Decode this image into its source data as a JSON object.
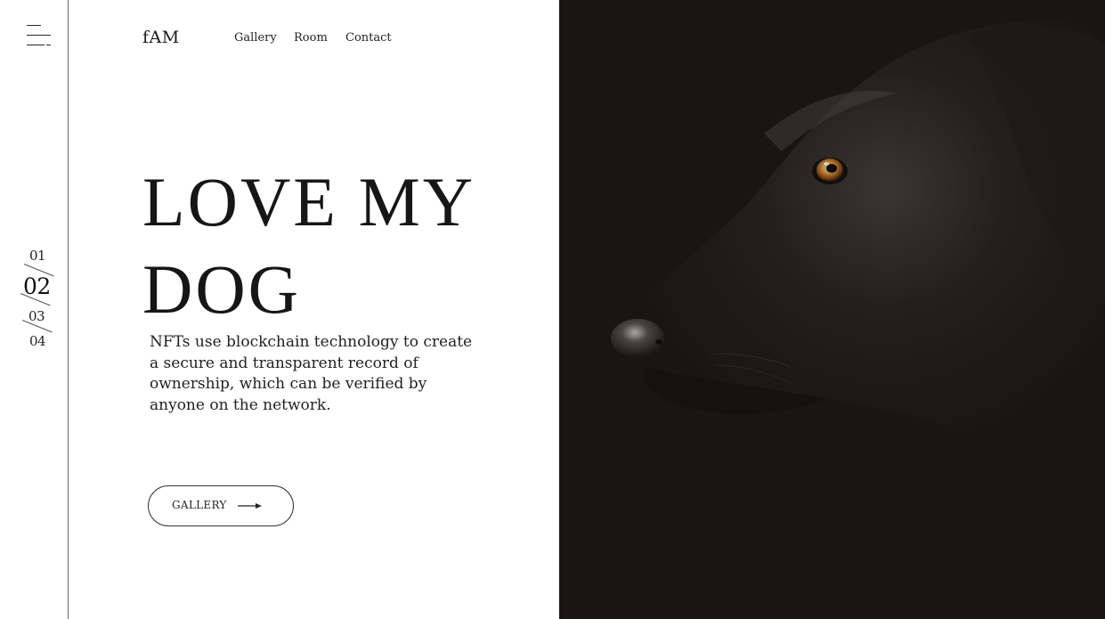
{
  "brand": {
    "logo": "fAM"
  },
  "nav": {
    "gallery": "Gallery",
    "room": "Room",
    "contact": "Contact"
  },
  "pager": {
    "p1": "01",
    "p2": "02",
    "p3": "03",
    "p4": "04",
    "active": "02"
  },
  "hero": {
    "title": "LOVE MY DOG",
    "description": "NFTs use blockchain technology to create a secure and transparent record of ownership, which can be verified by anyone on the network.",
    "cta_label": "GALLERY"
  },
  "icons": {
    "menu": "hamburger-menu-icon",
    "cta_arrow": "arrow-right-icon"
  },
  "colors": {
    "background": "#ffffff",
    "text": "#1a1a1a",
    "photo_bg": "#1a1413",
    "dog_eye": "#c07a2a"
  }
}
